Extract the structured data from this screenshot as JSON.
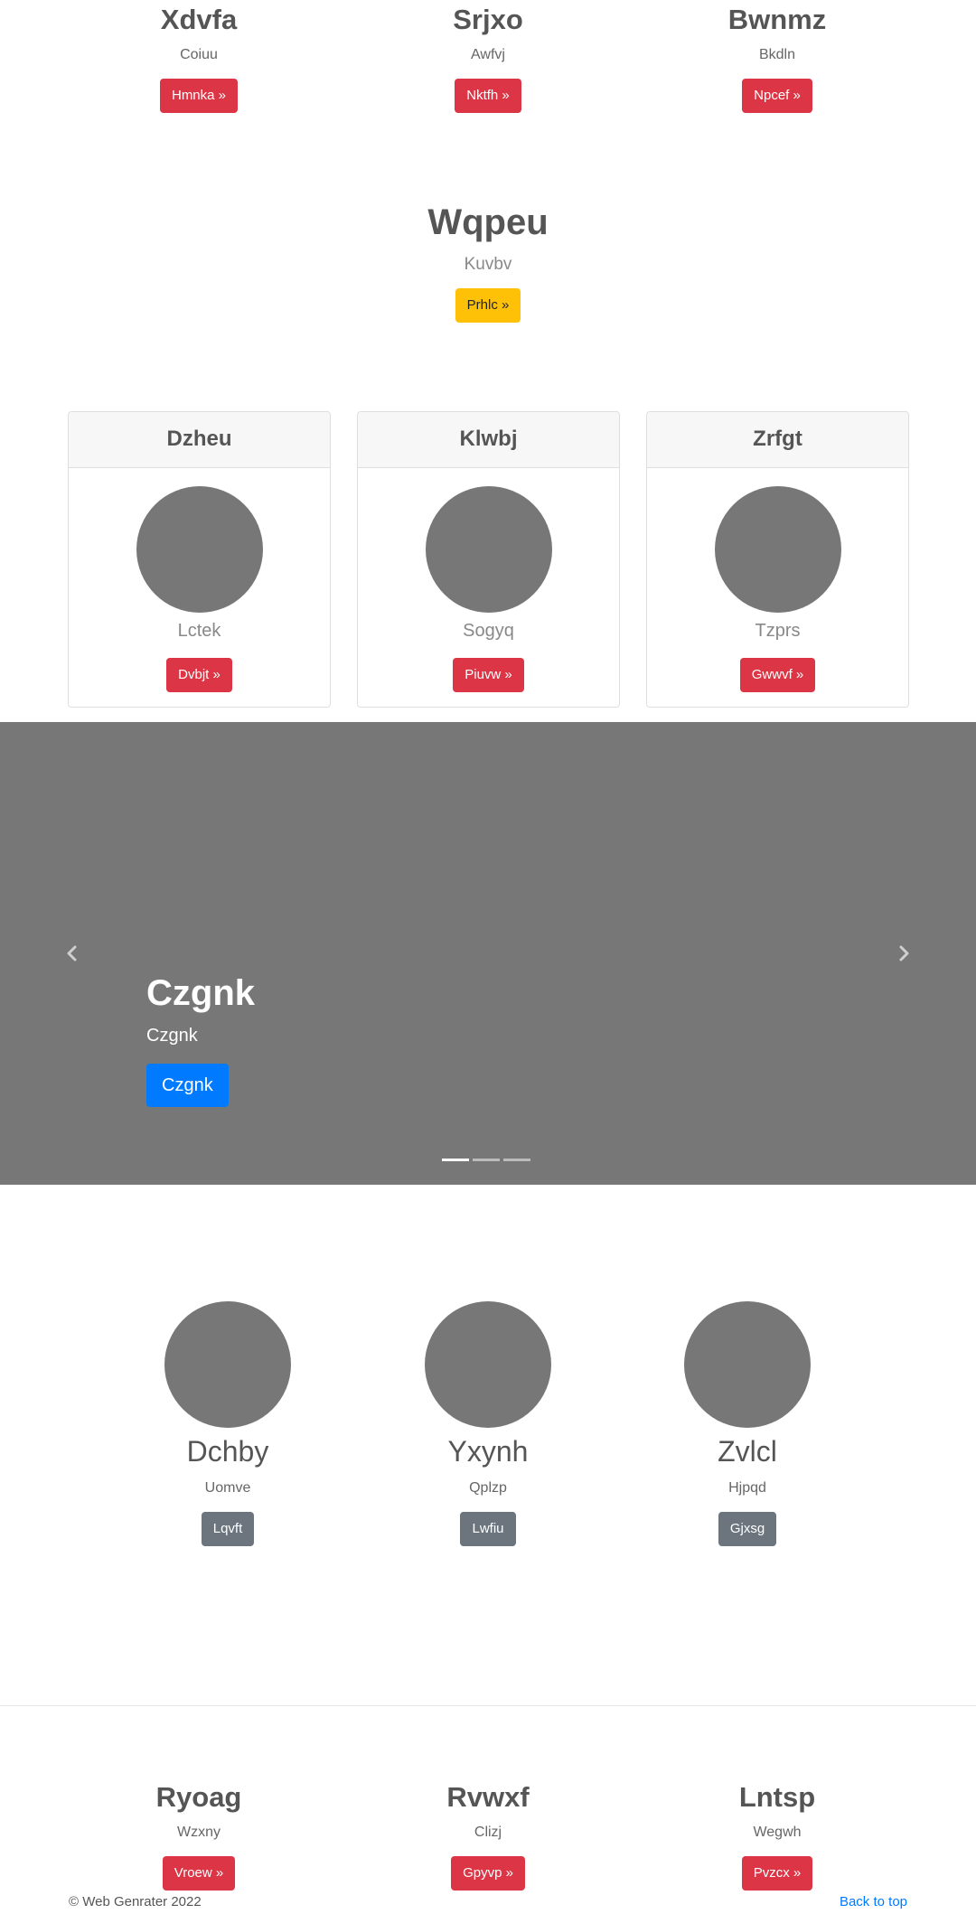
{
  "top_features": [
    {
      "title": "Xdvfa",
      "subtitle": "Coiuu",
      "button": "Hmnka »"
    },
    {
      "title": "Srjxo",
      "subtitle": "Awfvj",
      "button": "Nktfh »"
    },
    {
      "title": "Bwnmz",
      "subtitle": "Bkdln",
      "button": "Npcef »"
    }
  ],
  "hero": {
    "title": "Wqpeu",
    "lead": "Kuvbv",
    "button": "Prhlc »"
  },
  "cards": [
    {
      "header": "Dzheu",
      "text": "Lctek",
      "button": "Dvbjt »"
    },
    {
      "header": "Klwbj",
      "text": "Sogyq",
      "button": "Piuvw »"
    },
    {
      "header": "Zrfgt",
      "text": "Tzprs",
      "button": "Gwwvf »"
    }
  ],
  "carousel": {
    "title": "Czgnk",
    "text": "Czgnk",
    "button": "Czgnk",
    "prev_icon": "chevron-left-icon",
    "next_icon": "chevron-right-icon",
    "slide_count": 3,
    "active_slide": 1
  },
  "marketing": [
    {
      "title": "Dchby",
      "subtitle": "Uomve",
      "button": "Lqvft"
    },
    {
      "title": "Yxynh",
      "subtitle": "Qplzp",
      "button": "Lwfiu"
    },
    {
      "title": "Zvlcl",
      "subtitle": "Hjpqd",
      "button": "Gjxsg"
    }
  ],
  "bottom_features": [
    {
      "title": "Ryoag",
      "subtitle": "Wzxny",
      "button": "Vroew »"
    },
    {
      "title": "Rvwxf",
      "subtitle": "Clizj",
      "button": "Gpyvp »"
    },
    {
      "title": "Lntsp",
      "subtitle": "Wegwh",
      "button": "Pvzcx »"
    }
  ],
  "footer": {
    "copyright": "© Web Genrater 2022",
    "back_to_top": "Back to top"
  },
  "colors": {
    "danger": "#dc3545",
    "warning": "#ffc107",
    "secondary": "#6c757d",
    "primary": "#007bff",
    "placeholder": "#777777"
  }
}
